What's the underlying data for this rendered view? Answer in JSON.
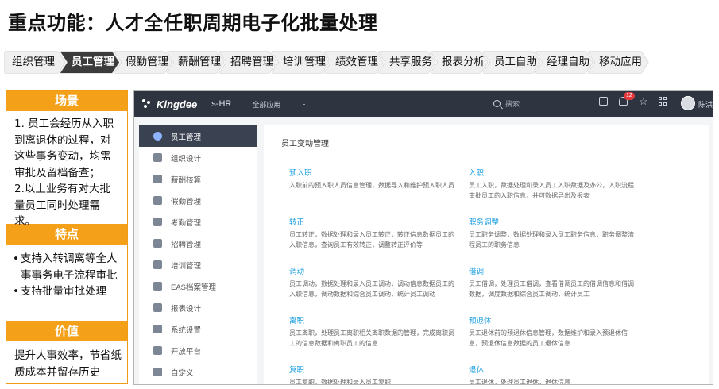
{
  "page_title": "重点功能：人才全任职周期电子化批量处理",
  "nav": [
    {
      "label": "组织管理",
      "active": false
    },
    {
      "label": "员工管理",
      "active": true
    },
    {
      "label": "假勤管理",
      "active": false
    },
    {
      "label": "薪酬管理",
      "active": false
    },
    {
      "label": "招聘管理",
      "active": false
    },
    {
      "label": "培训管理",
      "active": false
    },
    {
      "label": "绩效管理",
      "active": false
    },
    {
      "label": "共享服务",
      "active": false
    },
    {
      "label": "报表分析",
      "active": false
    },
    {
      "label": "员工自助",
      "active": false
    },
    {
      "label": "经理自助",
      "active": false
    },
    {
      "label": "移动应用",
      "active": false
    }
  ],
  "info": {
    "scene": {
      "heading": "场景",
      "lines": [
        "1. 员工会经历从入职到离退休的过程，对这些事务变动，均需审批及留档备查；",
        "2.以上业务有对大批量员工同时处理需求。"
      ]
    },
    "features": {
      "heading": "特点",
      "items": [
        "支持入转调离等全人事事务电子流程审批",
        "支持批量审批处理"
      ]
    },
    "value": {
      "heading": "价值",
      "text": "提升人事效率，节省纸质成本并留存历史"
    }
  },
  "app": {
    "brand": "Kingdee",
    "product": "s-HR",
    "menu_label": "全部应用",
    "menu_caret": "-",
    "search_placeholder": "搜索",
    "notification_count": "12",
    "user_name": "陈洪",
    "sidebar": [
      {
        "label": "员工管理",
        "icon": "person-icon",
        "active": true
      },
      {
        "label": "组织设计",
        "icon": "org-icon",
        "active": false
      },
      {
        "label": "薪酬核算",
        "icon": "book-icon",
        "active": false
      },
      {
        "label": "假勤管理",
        "icon": "clock-icon",
        "active": false
      },
      {
        "label": "考勤管理",
        "icon": "arrow-icon",
        "active": false
      },
      {
        "label": "招聘管理",
        "icon": "search-person-icon",
        "active": false
      },
      {
        "label": "培训管理",
        "icon": "training-icon",
        "active": false
      },
      {
        "label": "EAS档案管理",
        "icon": "gear-icon",
        "active": false
      },
      {
        "label": "报表设计",
        "icon": "report-icon",
        "active": false
      },
      {
        "label": "系统设置",
        "icon": "settings-icon",
        "active": false
      },
      {
        "label": "开放平台",
        "icon": "platform-icon",
        "active": false
      },
      {
        "label": "自定义",
        "icon": "custom-icon",
        "active": false
      }
    ],
    "main_title": "员工变动管理",
    "cards": [
      {
        "title": "预入职",
        "desc": "入职前的预入职人员信息管理，数据导入和维护预入职人员"
      },
      {
        "title": "入职",
        "desc": "员工入职，数据处理和录入员工入职数据及办公，入职流程审批员工的入职信息，并可数据导出及报表"
      },
      {
        "title": "转正",
        "desc": "员工转正，数据处理和录入员工转正，转正信息数据员工的入职信息，查询员工有效转正，调整转正评价等"
      },
      {
        "title": "职务调整",
        "desc": "员工职务调整，数据处理和录入员工职务信息，职务调整流程员工的职务信息"
      },
      {
        "title": "调动",
        "desc": "员工调动，数据处理和录入员工调动，调动信息数据员工的入职信息，调动数据和综合员工调动，统计员工调动"
      },
      {
        "title": "借调",
        "desc": "员工借调，处理员工借调，查看借调员工的借调信息和借调数据，调度数据和综合员工调动，统计员工"
      },
      {
        "title": "离职",
        "desc": "员工离职，处理员工离职相关离职数据的管理，完成离职员工的信息数据和离职员工的信息"
      },
      {
        "title": "预退休",
        "desc": "员工退休前的预退休信息管理，数据维护和录入预退休信息，预退休信息数据的员工退休信息"
      },
      {
        "title": "复职",
        "desc": "员工复职，数据处理和录入员工复职"
      },
      {
        "title": "退休",
        "desc": "员工退休，处理员工退休，退休信息"
      }
    ]
  }
}
